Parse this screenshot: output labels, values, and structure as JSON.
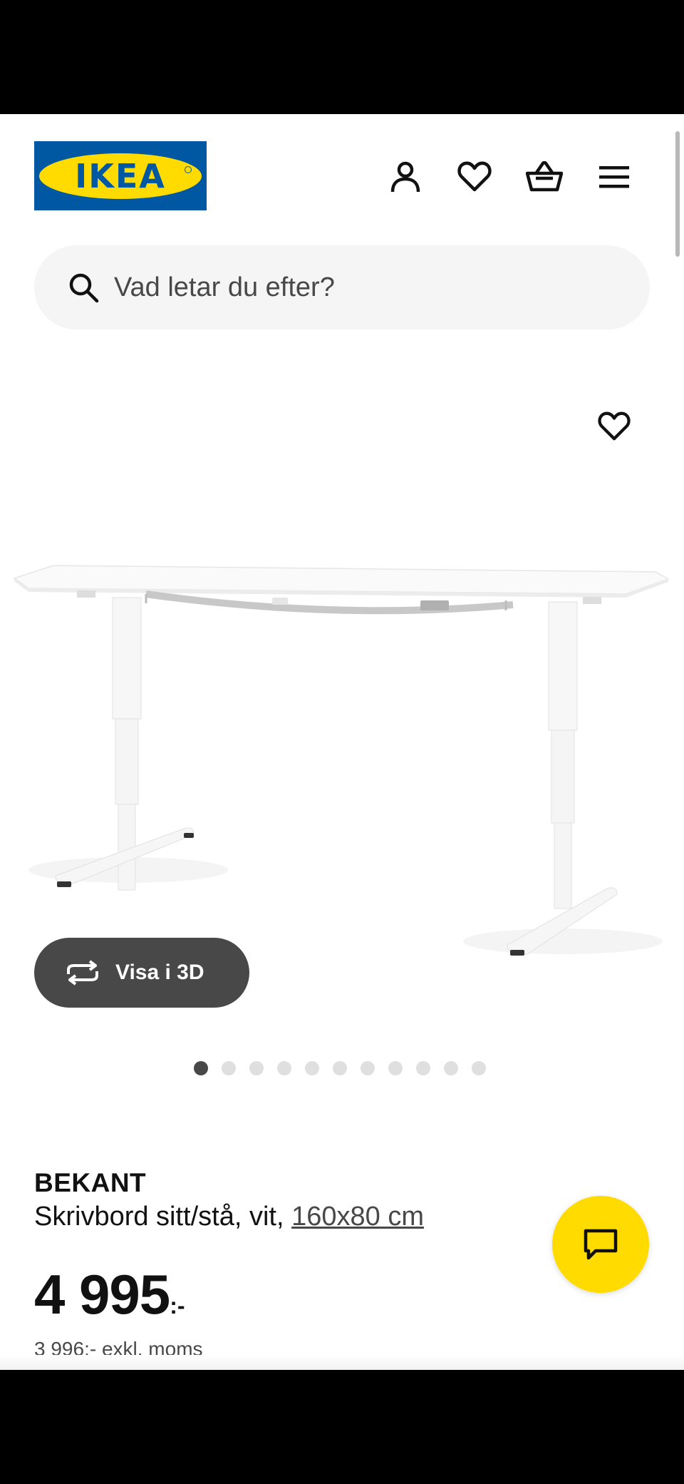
{
  "header": {
    "logo_text": "IKEA",
    "icons": [
      "account-icon",
      "heart-icon",
      "shopping-basket-icon",
      "menu-icon"
    ]
  },
  "search": {
    "placeholder": "Vad letar du efter?"
  },
  "gallery": {
    "view3d_label": "Visa i 3D",
    "image_count": 11,
    "active_image": 1
  },
  "product": {
    "brand": "BEKANT",
    "description": "Skrivbord sitt/stå, vit, ",
    "size_link": "160x80 cm",
    "price": "4 995",
    "price_suffix": ":-",
    "price_excl_vat": "3 996:- exkl. moms"
  },
  "colors": {
    "ikea_blue": "#0058a3",
    "ikea_yellow": "#ffdb00",
    "text_dark": "#111111",
    "button_grey": "#484848"
  }
}
